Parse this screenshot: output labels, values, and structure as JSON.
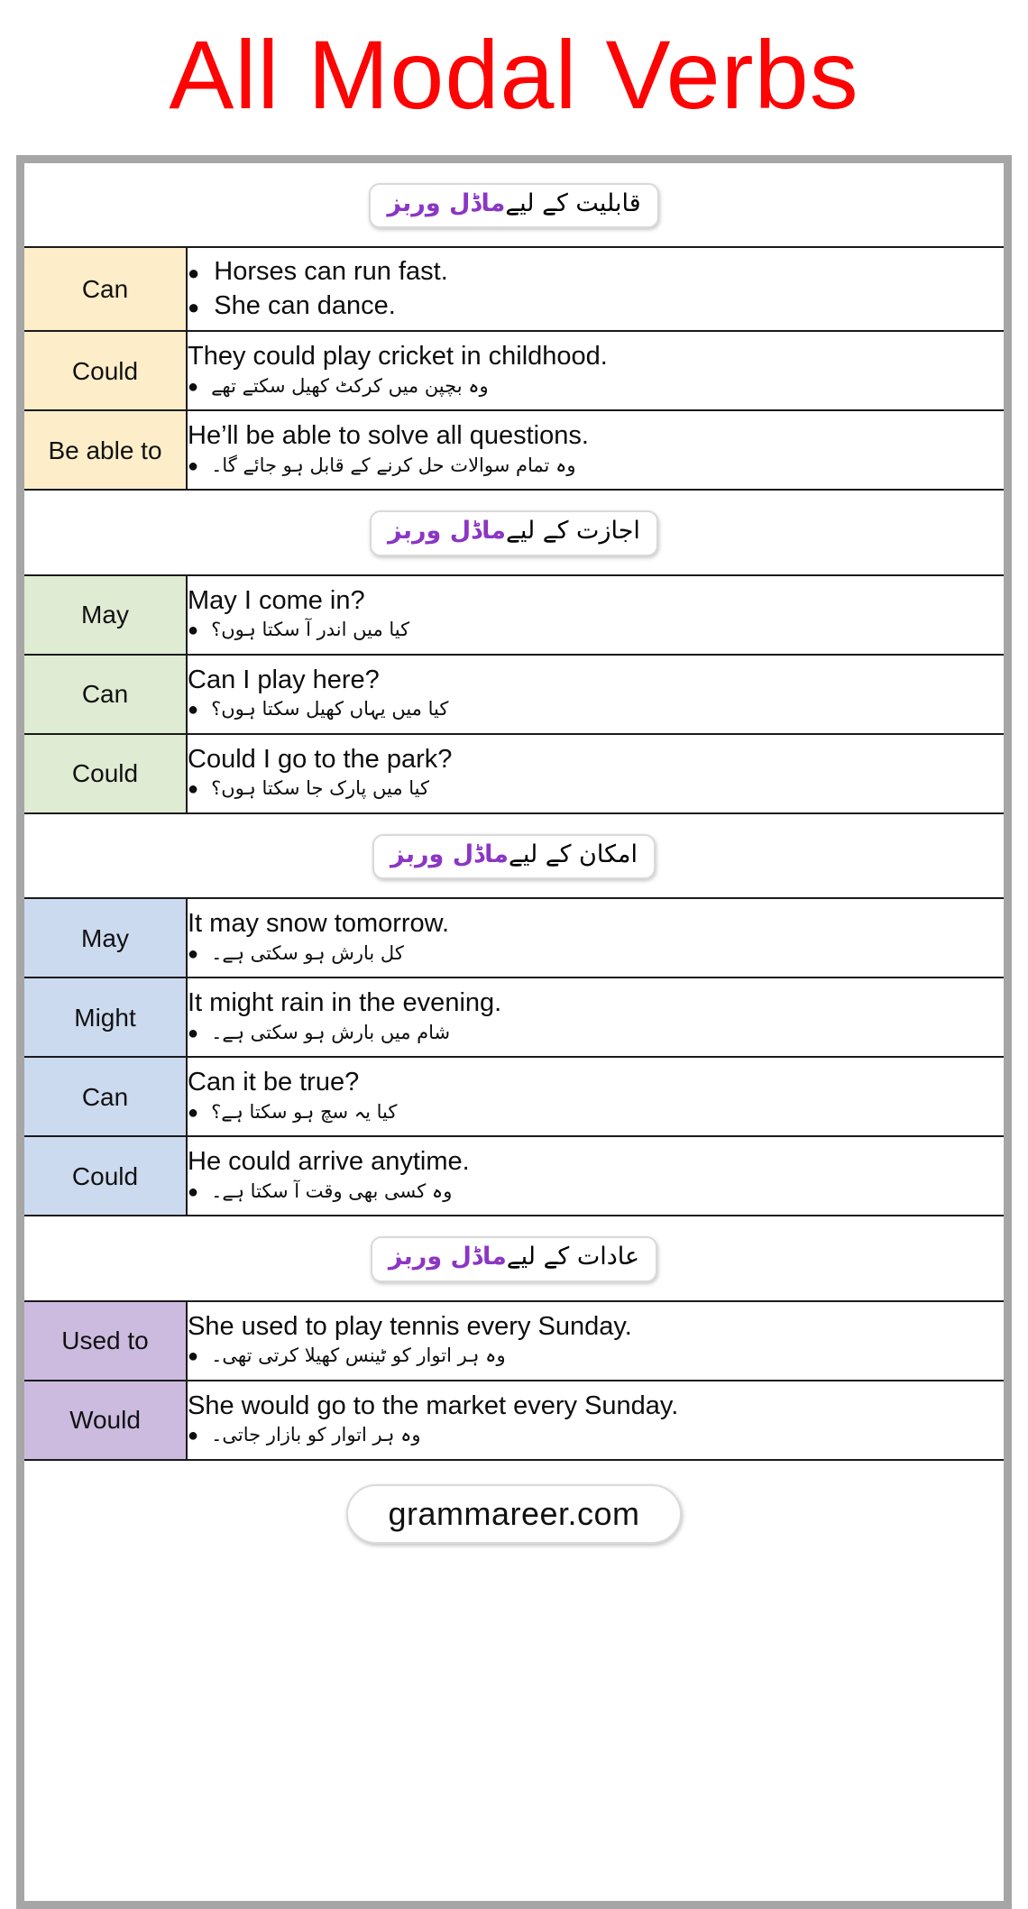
{
  "title": "All Modal Verbs",
  "title_color": "#fd0303",
  "footer": {
    "label": "grammareer.com"
  },
  "colors": {
    "frame": "#a6a6a6",
    "ability_bg": "#fdeec9",
    "permission_bg": "#dfebd3",
    "possibility_bg": "#ccdaef",
    "habit_bg": "#ccbbdf",
    "heading_accent": "#8b36c4"
  },
  "sections": [
    {
      "id": "ability",
      "heading_black": "قابلیت کے لیے",
      "heading_purple": "ماڈل وربز",
      "rows": [
        {
          "modal": "Can",
          "english_1": "Horses can run fast.",
          "english_2": "She can dance.",
          "urdu": ""
        },
        {
          "modal": "Could",
          "english_1": "They could play cricket in childhood.",
          "english_2": "",
          "urdu": "وہ بچپن میں کرکٹ کھیل سکتے تھے"
        },
        {
          "modal": "Be able to",
          "english_1": "He’ll be able to solve all questions.",
          "english_2": "",
          "urdu": "وہ تمام سوالات حل کرنے کے قابل ہو جائے گا۔"
        }
      ]
    },
    {
      "id": "permission",
      "heading_black": "اجازت کے لیے",
      "heading_purple": "ماڈل وربز",
      "rows": [
        {
          "modal": "May",
          "english_1": "May I come in?",
          "english_2": "",
          "urdu": "کیا میں اندر آ سکتا ہوں؟"
        },
        {
          "modal": "Can",
          "english_1": "Can I play here?",
          "english_2": "",
          "urdu": "کیا میں یہاں کھیل سکتا ہوں؟"
        },
        {
          "modal": "Could",
          "english_1": "Could I go to the park?",
          "english_2": "",
          "urdu": "کیا میں پارک جا سکتا ہوں؟"
        }
      ]
    },
    {
      "id": "possibility",
      "heading_black": "امکان کے لیے",
      "heading_purple": "ماڈل وربز",
      "rows": [
        {
          "modal": "May",
          "english_1": "It may snow tomorrow.",
          "english_2": "",
          "urdu": "کل بارش ہو سکتی ہے۔"
        },
        {
          "modal": "Might",
          "english_1": "It might rain in the evening.",
          "english_2": "",
          "urdu": "شام میں بارش ہو سکتی ہے۔"
        },
        {
          "modal": "Can",
          "english_1": "Can it be true?",
          "english_2": "",
          "urdu": "کیا یہ سچ ہو سکتا ہے؟"
        },
        {
          "modal": "Could",
          "english_1": "He could arrive anytime.",
          "english_2": "",
          "urdu": "وہ کسی بھی وقت آ سکتا ہے۔"
        }
      ]
    },
    {
      "id": "habit",
      "heading_black": "عادات کے لیے",
      "heading_purple": "ماڈل وربز",
      "rows": [
        {
          "modal": "Used to",
          "english_1": "She used to play tennis every Sunday.",
          "english_2": "",
          "urdu": "وہ ہر اتوار کو ٹینس کھیلا کرتی تھی۔"
        },
        {
          "modal": "Would",
          "english_1": "She would go to the market every Sunday.",
          "english_2": "",
          "urdu": "وہ ہر اتوار کو بازار جاتی۔"
        }
      ]
    }
  ]
}
